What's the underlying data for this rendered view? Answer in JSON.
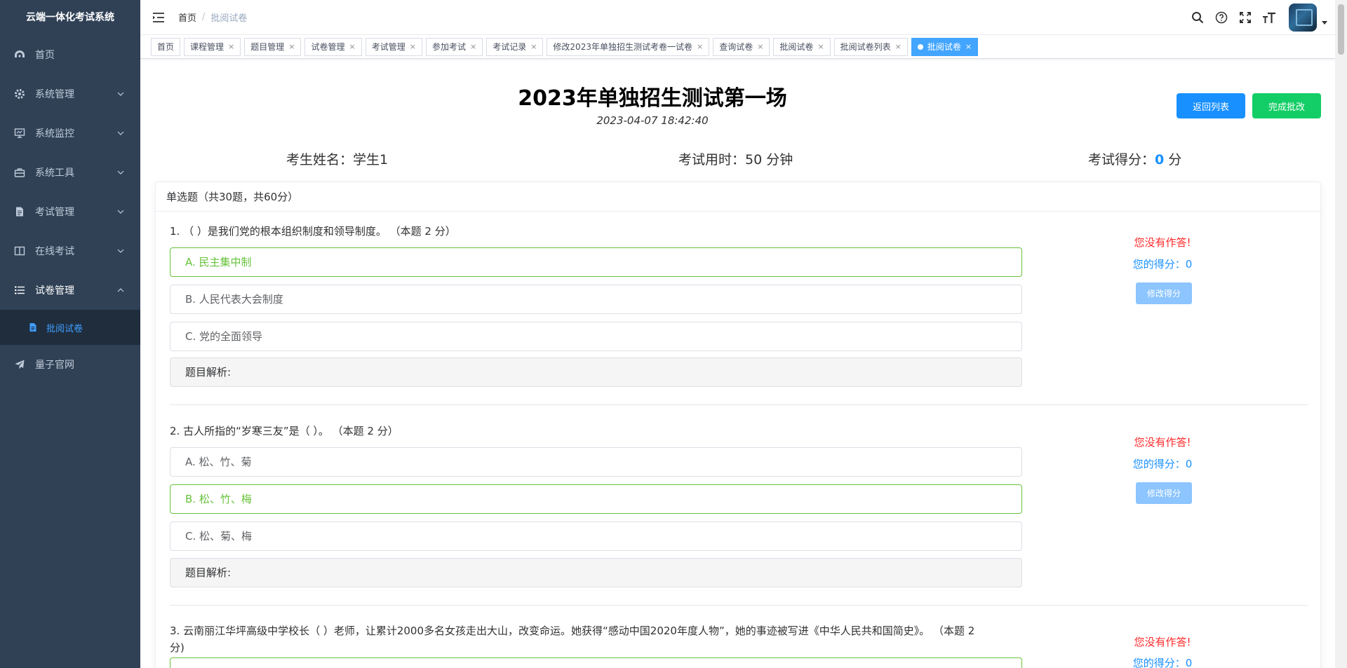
{
  "app": {
    "title": "云端一体化考试系统"
  },
  "sidebar": {
    "items": [
      {
        "label": "首页",
        "icon": "dashboard-icon"
      },
      {
        "label": "系统管理",
        "icon": "gear-icon"
      },
      {
        "label": "系统监控",
        "icon": "monitor-icon"
      },
      {
        "label": "系统工具",
        "icon": "toolbox-icon"
      },
      {
        "label": "考试管理",
        "icon": "document-icon"
      },
      {
        "label": "在线考试",
        "icon": "book-icon"
      },
      {
        "label": "试卷管理",
        "icon": "list-icon"
      },
      {
        "label": "批阅试卷",
        "icon": "file-icon"
      },
      {
        "label": "量子官网",
        "icon": "send-icon"
      }
    ]
  },
  "breadcrumb": {
    "home": "首页",
    "separator": "/",
    "current": "批阅试卷"
  },
  "tags": [
    {
      "label": "首页",
      "closable": false
    },
    {
      "label": "课程管理",
      "closable": true
    },
    {
      "label": "题目管理",
      "closable": true
    },
    {
      "label": "试卷管理",
      "closable": true
    },
    {
      "label": "考试管理",
      "closable": true
    },
    {
      "label": "参加考试",
      "closable": true
    },
    {
      "label": "考试记录",
      "closable": true
    },
    {
      "label": "修改2023年单独招生测试考卷一试卷",
      "closable": true
    },
    {
      "label": "查询试卷",
      "closable": true
    },
    {
      "label": "批阅试卷",
      "closable": true
    },
    {
      "label": "批阅试卷列表",
      "closable": true
    },
    {
      "label": "批阅试卷",
      "closable": true,
      "active": true
    }
  ],
  "tag_close": "×",
  "exam": {
    "title": "2023年单独招生测试第一场",
    "datetime": "2023-04-07 18:42:40",
    "back_button": "返回列表",
    "finish_button": "完成批改",
    "student_label": "考生姓名：",
    "student_name": "学生1",
    "duration_label": "考试用时：",
    "duration_value": "50 分钟",
    "score_label": "考试得分：",
    "score_value": "0",
    "score_unit": " 分"
  },
  "section": {
    "header": "单选题（共30题，共60分）"
  },
  "questions": [
    {
      "title": "1.   （ ）是我们党的根本组织制度和领导制度。 （本题 2 分）",
      "options": [
        {
          "text": "A. 民主集中制",
          "correct": true
        },
        {
          "text": "B. 人民代表大会制度",
          "correct": false
        },
        {
          "text": "C. 党的全面领导",
          "correct": false
        }
      ],
      "analysis": "题目解析:",
      "no_answer": "您没有作答!",
      "score": "您的得分：0",
      "modify_button": "修改得分"
    },
    {
      "title": "2.  古人所指的“岁寒三友”是（ ）。 （本题 2 分）",
      "options": [
        {
          "text": "A. 松、竹、菊",
          "correct": false
        },
        {
          "text": "B. 松、竹、梅",
          "correct": true
        },
        {
          "text": "C. 松、菊、梅",
          "correct": false
        }
      ],
      "analysis": "题目解析:",
      "no_answer": "您没有作答!",
      "score": "您的得分：0",
      "modify_button": "修改得分"
    },
    {
      "title": "3.  云南丽江华坪高级中学校长（ ）老师，让累计2000多名女孩走出大山，改变命运。她获得“感动中国2020年度人物”，她的事迹被写进《中华人民共和国简史》。 （本题 2",
      "title_cont": "分)",
      "no_answer": "您没有作答!",
      "score": "您的得分：0"
    }
  ],
  "colors": {
    "sidebar_bg": "#304156",
    "active_tag": "#42a5ff",
    "primary": "#1890ff",
    "success": "#13ce66",
    "correct": "#67c23a",
    "danger": "#ff2a2a"
  }
}
